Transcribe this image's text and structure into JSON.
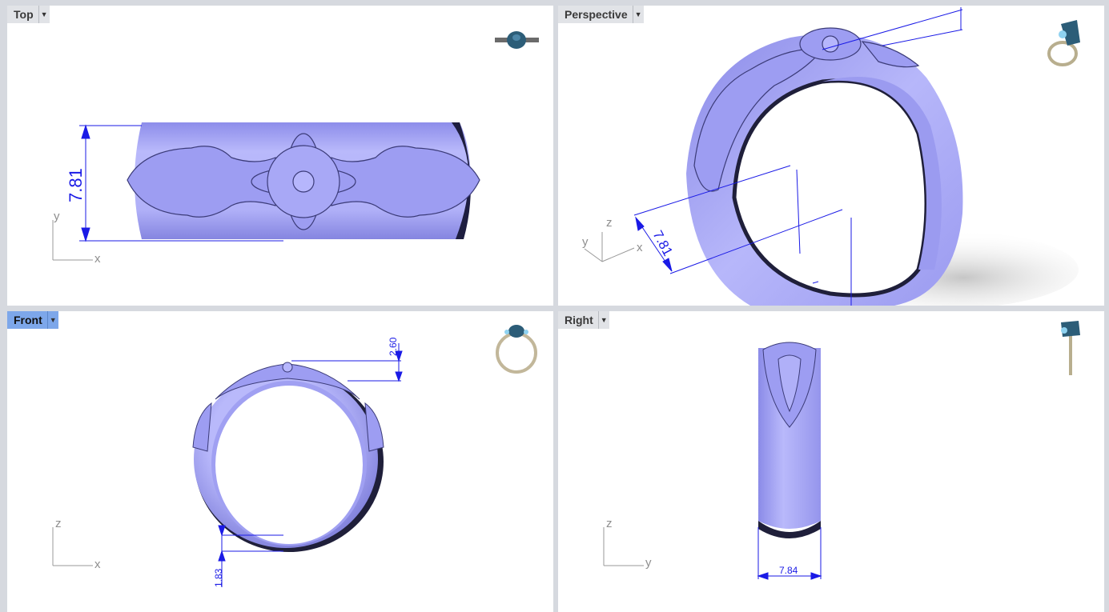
{
  "viewports": {
    "top": {
      "label": "Top",
      "dimension": "7.81",
      "axis_h": "x",
      "axis_v": "y"
    },
    "perspective": {
      "label": "Perspective",
      "dimension": "7.81",
      "axis_x": "x",
      "axis_y": "y",
      "axis_z": "z"
    },
    "front": {
      "label": "Front",
      "dimension_top": "2.60",
      "dimension_bottom": "1.83",
      "axis_h": "x",
      "axis_v": "z"
    },
    "right": {
      "label": "Right",
      "dimension": "7.84",
      "axis_h": "y",
      "axis_v": "z"
    }
  },
  "colors": {
    "ring_body": "#a6a6f5",
    "ring_shadow": "#2a2a5e",
    "dimension": "#1a1ae6",
    "active_tab": "#7da7ea",
    "viewport_bg": "#ffffff",
    "app_bg": "#d6d9df"
  },
  "icons": [
    "dropdown-arrow-icon",
    "ring-preview-icon"
  ]
}
